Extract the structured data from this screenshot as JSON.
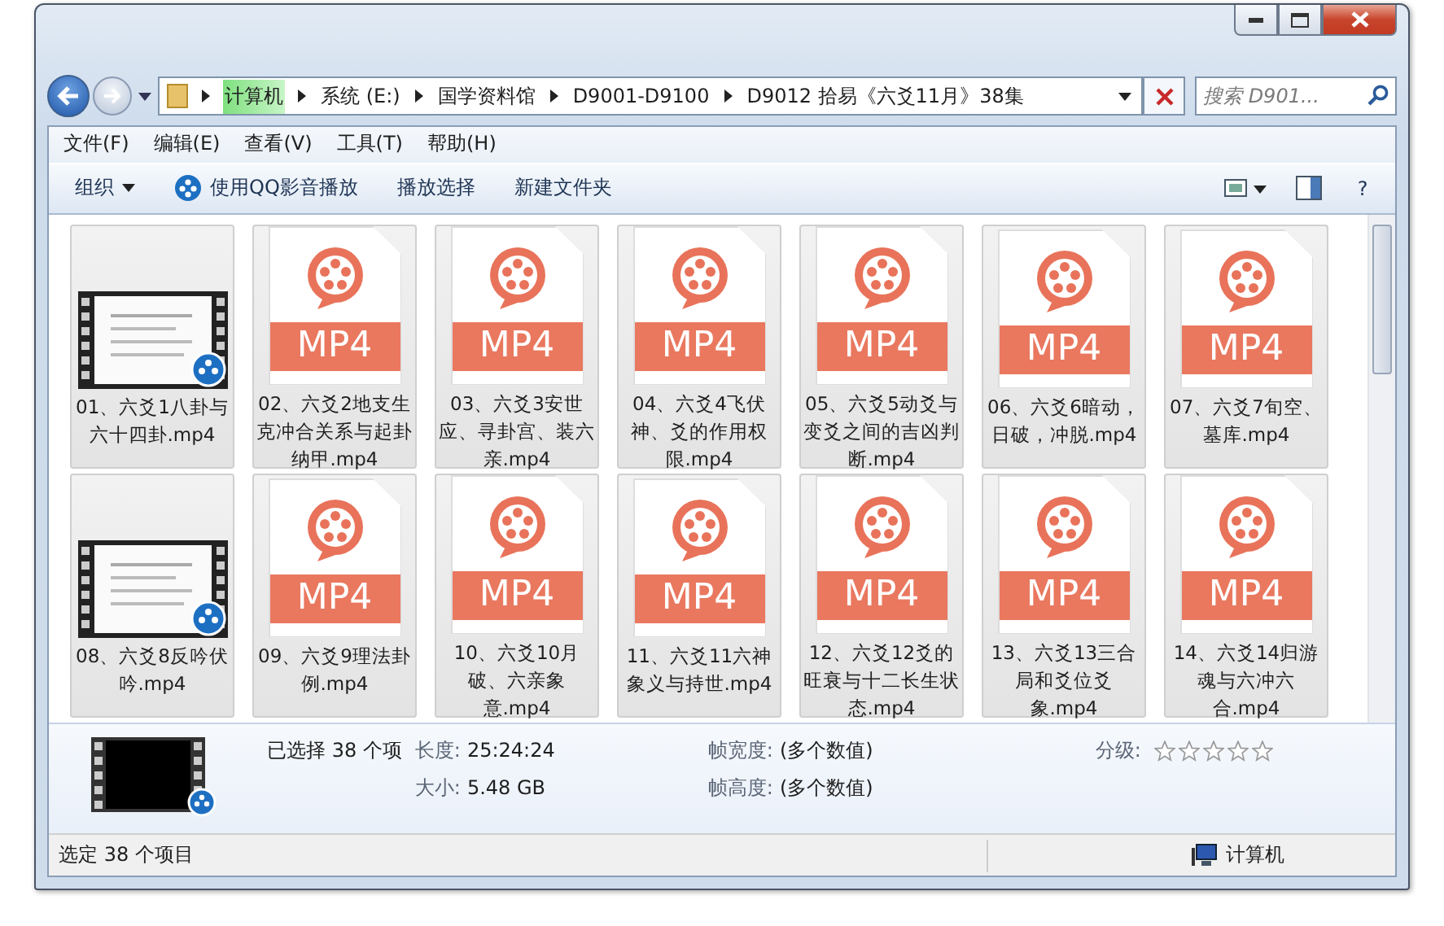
{
  "address_bar": {
    "crumbs": [
      "计算机",
      "系统 (E:)",
      "国学资料馆",
      "D9001-D9100",
      "D9012 拾易《六爻11月》38集"
    ],
    "search": {
      "placeholder": "搜索 D901..."
    }
  },
  "menu": [
    "文件(F)",
    "编辑(E)",
    "查看(V)",
    "工具(T)",
    "帮助(H)"
  ],
  "toolbar": {
    "organize": "组织",
    "play_with": "使用QQ影音播放",
    "play_selection": "播放选择",
    "new_folder": "新建文件夹",
    "help": "?"
  },
  "files": [
    {
      "name": "01、六爻1八卦与六十四卦.mp4",
      "kind": "video",
      "selected": true
    },
    {
      "name": "02、六爻2地支生克冲合关系与起卦纳甲.mp4",
      "kind": "mp4",
      "icon_label": "MP4",
      "selected": true
    },
    {
      "name": "03、六爻3安世应、寻卦宫、装六亲.mp4",
      "kind": "mp4",
      "icon_label": "MP4",
      "selected": true
    },
    {
      "name": "04、六爻4飞伏神、爻的作用权限.mp4",
      "kind": "mp4",
      "icon_label": "MP4",
      "selected": true
    },
    {
      "name": "05、六爻5动爻与变爻之间的吉凶判断.mp4",
      "kind": "mp4",
      "icon_label": "MP4",
      "selected": true
    },
    {
      "name": "06、六爻6暗动，日破，冲脱.mp4",
      "kind": "mp4",
      "icon_label": "MP4",
      "selected": true
    },
    {
      "name": "07、六爻7旬空、墓库.mp4",
      "kind": "mp4",
      "icon_label": "MP4",
      "selected": true
    },
    {
      "name": "08、六爻8反吟伏吟.mp4",
      "kind": "video",
      "selected": true
    },
    {
      "name": "09、六爻9理法卦例.mp4",
      "kind": "mp4",
      "icon_label": "MP4",
      "selected": true
    },
    {
      "name": "10、六爻10月破、六亲象意.mp4",
      "kind": "mp4",
      "icon_label": "MP4",
      "selected": true
    },
    {
      "name": "11、六爻11六神象义与持世.mp4",
      "kind": "mp4",
      "icon_label": "MP4",
      "selected": true
    },
    {
      "name": "12、六爻12爻的旺衰与十二长生状态.mp4",
      "kind": "mp4",
      "icon_label": "MP4",
      "selected": true
    },
    {
      "name": "13、六爻13三合局和爻位爻象.mp4",
      "kind": "mp4",
      "icon_label": "MP4",
      "selected": true
    },
    {
      "name": "14、六爻14归游魂与六冲六合.mp4",
      "kind": "mp4",
      "icon_label": "MP4",
      "selected": true
    }
  ],
  "details": {
    "selection": "已选择 38 个项",
    "length_label": "长度:",
    "length": "25:24:24",
    "size_label": "大小:",
    "size": "5.48 GB",
    "frame_width_label": "帧宽度:",
    "frame_width": "(多个数值)",
    "frame_height_label": "帧高度:",
    "frame_height": "(多个数值)",
    "rating_label": "分级:",
    "stars": 0
  },
  "status_bar": {
    "text": "选定 38 个项目",
    "location": "计算机"
  }
}
